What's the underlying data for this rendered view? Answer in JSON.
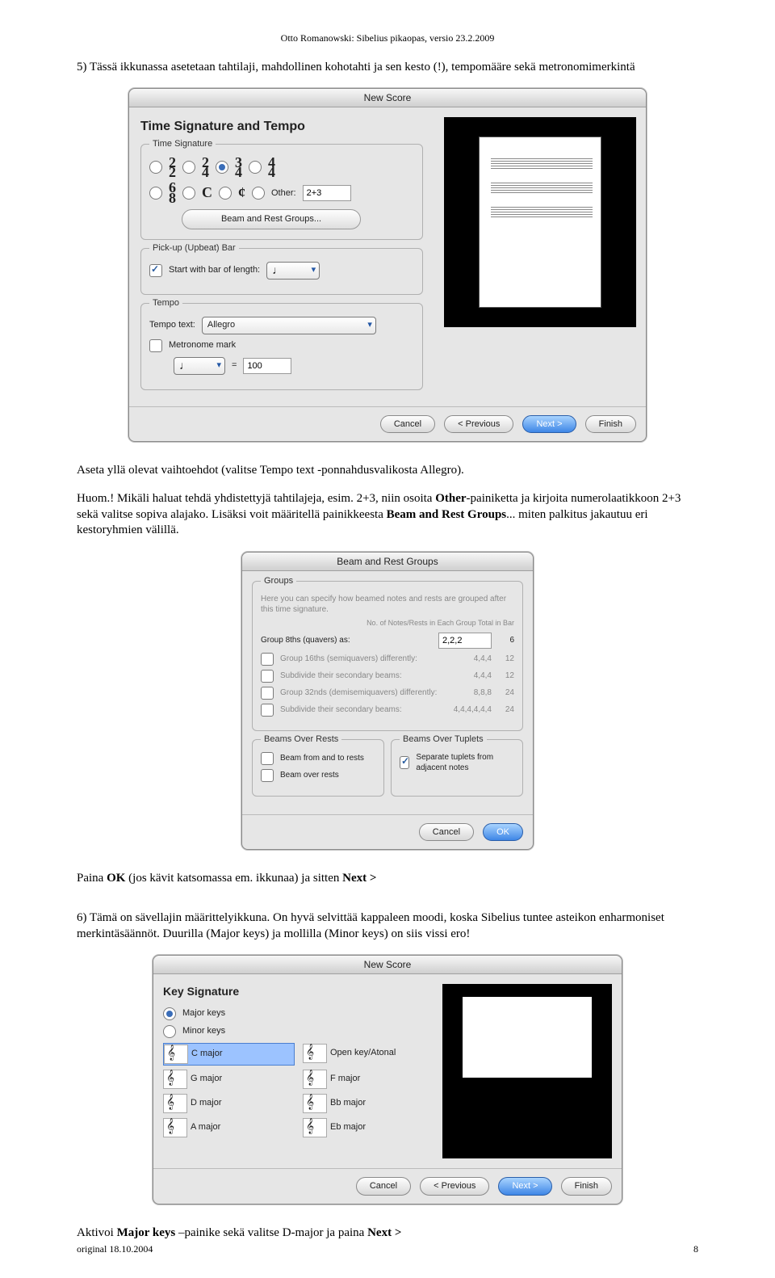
{
  "header": "Otto Romanowski: Sibelius pikaopas, versio 23.2.2009",
  "p1": "5) Tässä ikkunassa asetetaan tahtilaji, mahdollinen kohotahti ja sen kesto (!), tempomääre sekä metronomimerkintä",
  "dlg1": {
    "title": "New Score",
    "heading": "Time Signature and Tempo",
    "grp_time": "Time Signature",
    "ts": [
      "2/2",
      "2/4",
      "3/4",
      "4/4",
      "6/8",
      "C",
      "¢"
    ],
    "other": "Other:",
    "other_val": "2+3",
    "beam_btn": "Beam and Rest Groups...",
    "grp_pickup": "Pick-up (Upbeat) Bar",
    "pickup_chk": "Start with bar of length:",
    "grp_tempo": "Tempo",
    "tempo_lbl": "Tempo text:",
    "tempo_val": "Allegro",
    "metro_chk": "Metronome mark",
    "metro_eq": "=",
    "metro_val": "100",
    "btns": {
      "cancel": "Cancel",
      "prev": "< Previous",
      "next": "Next >",
      "finish": "Finish"
    }
  },
  "p2a": "Aseta yllä olevat vaihtoehdot (valitse Tempo text -ponnahdusvalikosta Allegro).",
  "p2b_pre": "Huom.! Mikäli haluat tehdä yhdistettyjä tahtilajeja, esim. 2+3, niin osoita ",
  "p2b_bold1": "Other",
  "p2b_mid": "-painiketta ja kirjoita numerolaatikkoon 2+3 sekä valitse sopiva alajako. Lisäksi voit määritellä painikkeesta ",
  "p2b_bold2": "Beam and Rest Groups",
  "p2b_end": "... miten palkitus jakautuu eri kestoryhmien välillä.",
  "dlg2": {
    "title": "Beam and Rest Groups",
    "grp_groups": "Groups",
    "note": "Here you can specify how beamed notes and rests are grouped after this time signature.",
    "col_head": "No. of Notes/Rests in Each Group  Total in Bar",
    "r_group8": "Group 8ths (quavers) as:",
    "r_group8_v": "2,2,2",
    "r_group8_t": "6",
    "r_16": "Group 16ths (semiquavers) differently:",
    "r_16_v": "4,4,4",
    "r_16_t": "12",
    "r_sub16": "Subdivide their secondary beams:",
    "r_sub16_v": "4,4,4",
    "r_sub16_t": "12",
    "r_32": "Group 32nds (demisemiquavers) differently:",
    "r_32_v": "8,8,8",
    "r_32_t": "24",
    "r_sub32": "Subdivide their secondary beams:",
    "r_sub32_v": "4,4,4,4,4,4",
    "r_sub32_t": "24",
    "grp_rests": "Beams Over Rests",
    "rests1": "Beam from and to rests",
    "rests2": "Beam over rests",
    "grp_tuplets": "Beams Over Tuplets",
    "tuplets1": "Separate tuplets from adjacent notes",
    "ok": "OK",
    "cancel": "Cancel"
  },
  "p3_pre": "Paina ",
  "p3_b1": "OK",
  "p3_mid": " (jos kävit katsomassa em. ikkunaa) ja sitten ",
  "p3_b2": "Next >",
  "p4": "6) Tämä on sävellajin määrittelyikkuna. On hyvä selvittää kappaleen moodi, koska Sibelius tuntee asteikon enharmoniset merkintäsäännöt. Duurilla (Major keys) ja mollilla (Minor keys) on siis vissi ero!",
  "dlg3": {
    "title": "New Score",
    "heading": "Key Signature",
    "major": "Major keys",
    "minor": "Minor keys",
    "keys_l": [
      "C major",
      "G major",
      "D major",
      "A major"
    ],
    "keys_r": [
      "Open key/Atonal",
      "F major",
      "Bb major",
      "Eb major"
    ],
    "btns": {
      "cancel": "Cancel",
      "prev": "< Previous",
      "next": "Next >",
      "finish": "Finish"
    }
  },
  "p5_pre": "Aktivoi ",
  "p5_b1": "Major keys",
  "p5_mid": " –painike sekä valitse D-major ja paina ",
  "p5_b2": "Next >",
  "footer_l": "original 18.10.2004",
  "footer_r": "8"
}
